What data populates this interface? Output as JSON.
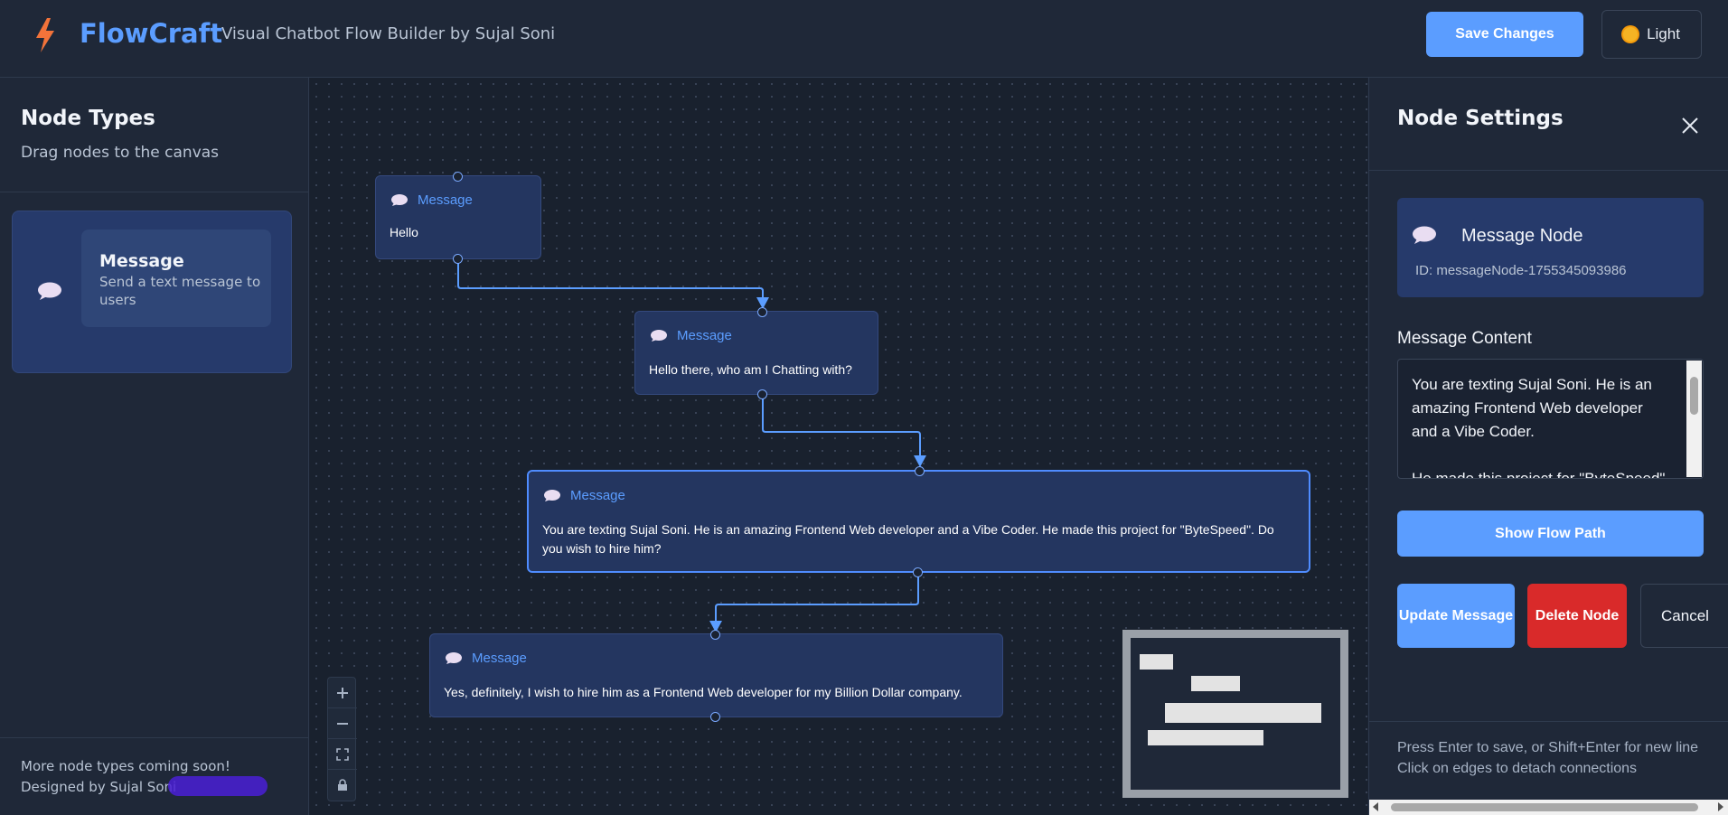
{
  "header": {
    "app_name": "FlowCraft",
    "subtitle": "Visual Chatbot Flow Builder by Sujal Soni",
    "save_label": "Save Changes",
    "theme_label": "Light",
    "accent": "#5b9dff"
  },
  "sidebar": {
    "title": "Node Types",
    "subtitle": "Drag nodes to the canvas",
    "node_types": [
      {
        "name": "Message",
        "description": "Send a text message to users",
        "icon": "speech-bubble-icon"
      }
    ],
    "footer_line1": "More node types coming soon!",
    "footer_line2": "Designed by Sujal Soni"
  },
  "canvas": {
    "nodes": [
      {
        "type": "Message",
        "text": "Hello"
      },
      {
        "type": "Message",
        "text": "Hello there, who am I Chatting with?"
      },
      {
        "type": "Message",
        "text": "You are texting Sujal Soni. He is an amazing Frontend Web developer and a Vibe Coder. He made this project for \"ByteSpeed\". Do you wish to hire him?",
        "selected": true
      },
      {
        "type": "Message",
        "text": "Yes, definitely, I wish to hire him as a Frontend Web developer for my Billion Dollar company."
      }
    ],
    "controls": [
      "zoom-in",
      "zoom-out",
      "fit-view",
      "lock"
    ]
  },
  "panel": {
    "title": "Node Settings",
    "node_title": "Message Node",
    "node_id": "ID: messageNode-1755345093986",
    "content_label": "Message Content",
    "content_value": "You are texting Sujal Soni. He is an amazing Frontend Web developer and a Vibe Coder.\n\nHe made this project for \"ByteSpeed\". Do you wish to hire him?",
    "show_path_label": "Show Flow Path",
    "update_label": "Update Message",
    "delete_label": "Delete Node",
    "cancel_label": "Cancel",
    "hint1": "Press Enter to save, or Shift+Enter for new line",
    "hint2": "Click on edges to detach connections",
    "danger_color": "#d92a2a"
  }
}
